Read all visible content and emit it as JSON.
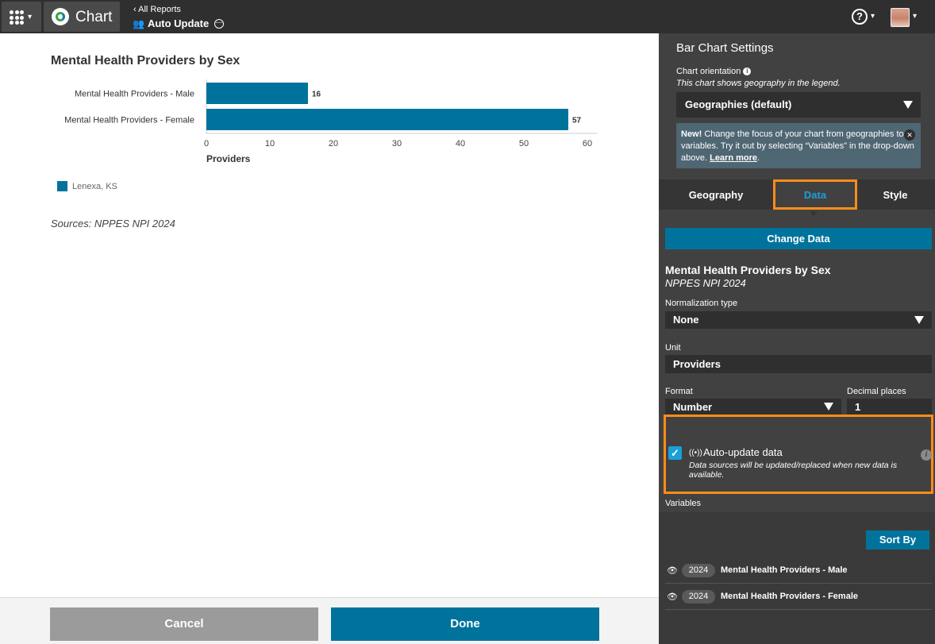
{
  "header": {
    "app_name": "Chart",
    "back_link": "All Reports",
    "report_name": "Auto Update",
    "help_label": "?"
  },
  "chart_data": {
    "type": "bar",
    "orientation": "horizontal",
    "title": "Mental Health Providers by Sex",
    "categories": [
      "Mental Health Providers - Male",
      "Mental Health Providers - Female"
    ],
    "series": [
      {
        "name": "Lenexa, KS",
        "values": [
          16,
          57
        ],
        "color": "#00739c"
      }
    ],
    "data_labels": [
      "16",
      "57"
    ],
    "xlabel": "Providers",
    "xlim": [
      0,
      60
    ],
    "xticks": [
      0,
      10,
      20,
      30,
      40,
      50,
      60
    ],
    "legend_position": "bottom-left",
    "grid": false
  },
  "main": {
    "chart_title": "Mental Health Providers by Sex",
    "legend_label": "Lenexa, KS",
    "sources": "Sources: NPPES NPI 2024"
  },
  "footer": {
    "cancel_label": "Cancel",
    "done_label": "Done"
  },
  "panel": {
    "title": "Bar Chart Settings",
    "orientation_label": "Chart orientation",
    "orientation_sub": "This chart shows geography in the legend.",
    "orientation_value": "Geographies (default)",
    "new_box": {
      "badge": "New!",
      "text": " Change the focus of your chart from geographies to variables. Try it out by selecting “Variables” in the drop-down above. ",
      "link": "Learn more",
      "end": "."
    },
    "tabs": [
      "Geography",
      "Data",
      "Style"
    ],
    "change_data_label": "Change Data",
    "data_title": "Mental Health Providers by Sex",
    "data_source": "NPPES NPI 2024",
    "normalization_label": "Normalization type",
    "normalization_value": "None",
    "unit_label": "Unit",
    "unit_value": "Providers",
    "format_label": "Format",
    "format_value": "Number",
    "decimal_label": "Decimal places",
    "decimal_value": "1",
    "auto_update": {
      "checked": true,
      "label": "Auto-update data",
      "description": "Data sources will be updated/replaced when new data is available."
    },
    "variables_label": "Variables",
    "sort_label": "Sort By",
    "variables": [
      {
        "year": "2024",
        "name": "Mental Health Providers - Male"
      },
      {
        "year": "2024",
        "name": "Mental Health Providers - Female"
      }
    ]
  },
  "colors": {
    "accent": "#00739c",
    "highlight": "#ff8c1a",
    "active_tab": "#1aa0d8",
    "panel_bg": "#414141",
    "topbar_bg": "#2f2f2f"
  }
}
